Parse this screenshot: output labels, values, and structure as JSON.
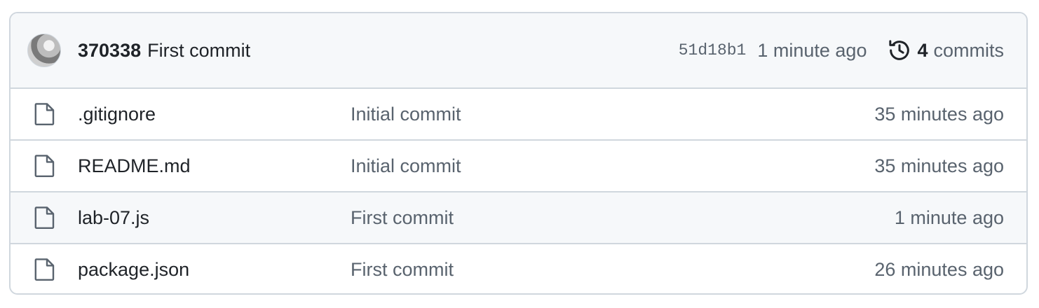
{
  "latest_commit": {
    "author": "370338",
    "message": "First commit",
    "sha": "51d18b1",
    "time": "1 minute ago",
    "commit_count": "4",
    "commits_label": "commits"
  },
  "files": [
    {
      "name": ".gitignore",
      "message": "Initial commit",
      "time": "35 minutes ago"
    },
    {
      "name": "README.md",
      "message": "Initial commit",
      "time": "35 minutes ago"
    },
    {
      "name": "lab-07.js",
      "message": "First commit",
      "time": "1 minute ago"
    },
    {
      "name": "package.json",
      "message": "First commit",
      "time": "26 minutes ago"
    }
  ],
  "icons": {
    "file": "file-icon",
    "history": "history-icon",
    "avatar": "avatar"
  },
  "colors": {
    "border": "#d0d7de",
    "header_bg": "#f6f8fa",
    "text": "#1f2328",
    "muted": "#59636e"
  }
}
